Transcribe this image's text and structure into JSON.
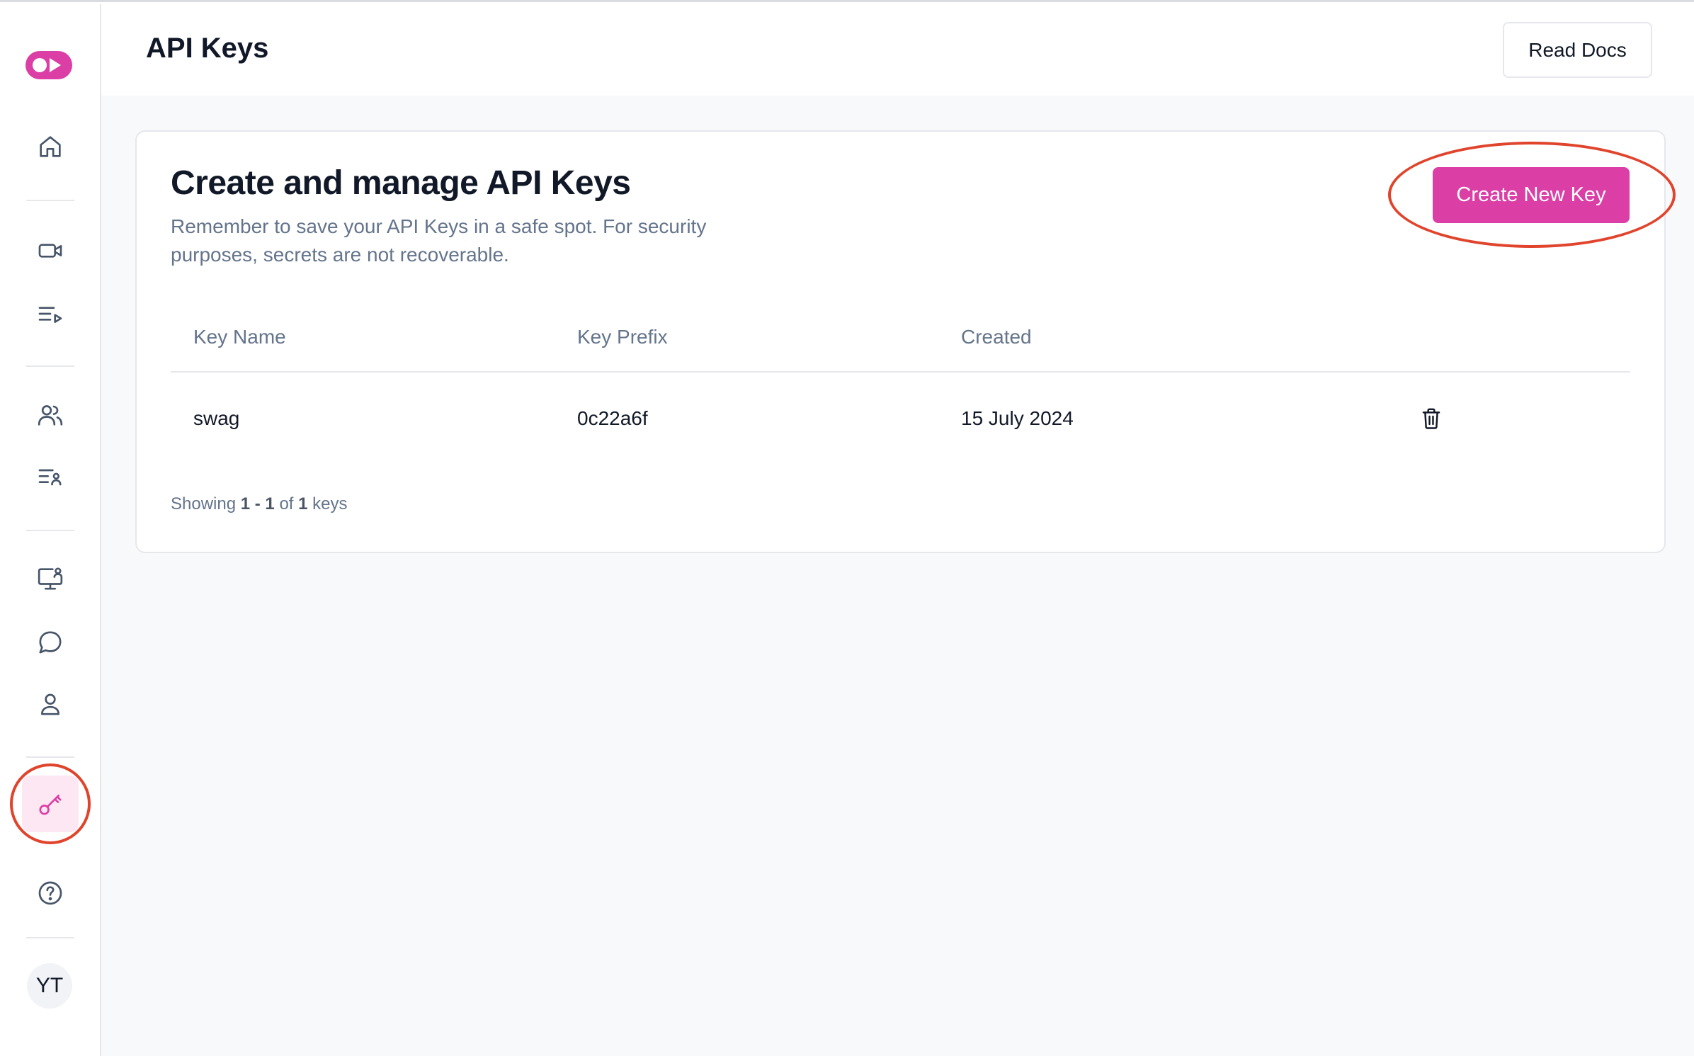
{
  "header": {
    "title": "API Keys",
    "read_docs_label": "Read Docs"
  },
  "sidebar": {
    "items": [
      {
        "icon": "home-icon"
      },
      {
        "icon": "video-icon"
      },
      {
        "icon": "playlist-icon"
      },
      {
        "icon": "users-icon"
      },
      {
        "icon": "user-list-icon"
      },
      {
        "icon": "monitor-user-icon"
      },
      {
        "icon": "chat-icon"
      },
      {
        "icon": "user-icon"
      },
      {
        "icon": "key-icon",
        "active": true
      },
      {
        "icon": "help-icon"
      }
    ],
    "avatar_initials": "YT"
  },
  "card": {
    "title": "Create and manage API Keys",
    "description": "Remember to save your API Keys in a safe spot. For security purposes, secrets are not recoverable.",
    "create_button_label": "Create New Key"
  },
  "table": {
    "columns": [
      "Key Name",
      "Key Prefix",
      "Created"
    ],
    "rows": [
      {
        "name": "swag",
        "prefix": "0c22a6f",
        "created": "15 July 2024"
      }
    ]
  },
  "footer": {
    "prefix": "Showing",
    "range": "1 - 1",
    "of": "of",
    "total": "1",
    "suffix": "keys"
  },
  "colors": {
    "accent": "#db3fa6",
    "annotation": "#e0442c",
    "muted_text": "#64748b"
  }
}
